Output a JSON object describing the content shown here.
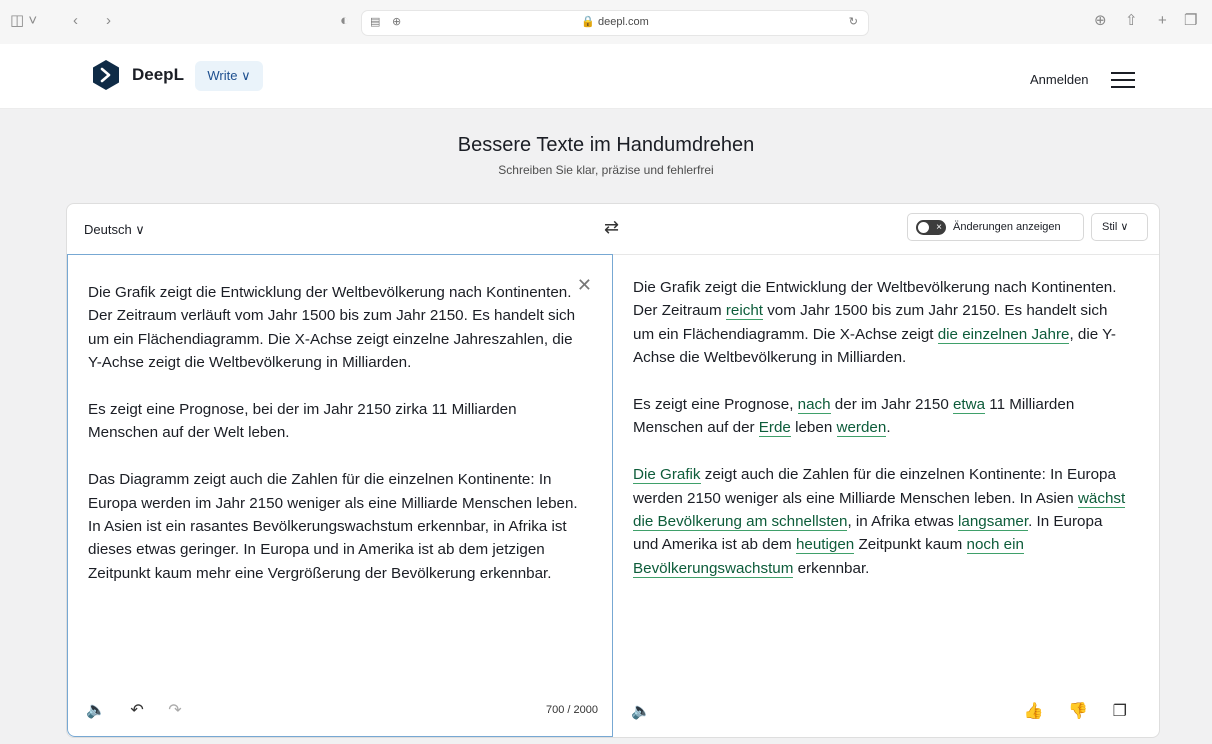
{
  "browser": {
    "url": "deepl.com"
  },
  "header": {
    "brand": "DeepL",
    "write_label": "Write ∨",
    "login": "Anmelden"
  },
  "hero": {
    "title": "Bessere Texte im Handumdrehen",
    "subtitle": "Schreiben Sie klar, präzise und fehlerfrei"
  },
  "editor": {
    "language": "Deutsch ∨",
    "changes_label": "Änderungen anzeigen",
    "style_label": "Stil ∨",
    "counter": "700 / 2000",
    "source_paragraphs": [
      "Die Grafik zeigt die Entwicklung der Weltbevölkerung nach Kontinenten. Der Zeitraum verläuft vom Jahr 1500 bis zum Jahr 2150. Es handelt sich um ein Flächendiagramm. Die X-Achse zeigt einzelne Jahreszahlen, die Y-Achse zeigt die Weltbevölkerung in Milliarden.",
      "Es zeigt eine Prognose, bei der im Jahr 2150 zirka 11 Milliarden Menschen auf der Welt leben.",
      "Das Diagramm zeigt auch die Zahlen für die einzelnen Kontinente: In Europa werden im Jahr 2150 weniger als eine Milliarde Menschen leben. In Asien ist ein rasantes Bevölkerungswachstum erkennbar, in Afrika ist dieses etwas geringer. In Europa und in Amerika ist ab dem jetzigen Zeitpunkt kaum mehr eine Vergrößerung der Bevölkerung erkennbar."
    ],
    "result": {
      "p1": {
        "a": "Die Grafik zeigt die Entwicklung der Weltbevölkerung nach Kontinenten. Der Zeitraum ",
        "h1": "reicht",
        "b": " vom Jahr 1500 bis zum Jahr 2150. Es handelt sich um ein Flächendiagramm. Die X-Achse zeigt ",
        "h2": "die einzelnen Jahre",
        "c": ", die Y-Achse die Weltbevölkerung in Milliarden."
      },
      "p2": {
        "a": "Es zeigt eine Prognose, ",
        "h1": "nach",
        "b": " der im Jahr 2150 ",
        "h2": "etwa",
        "c": " 11 Milliarden Menschen auf der ",
        "h3": "Erde",
        "d": " leben ",
        "h4": "werden",
        "e": "."
      },
      "p3": {
        "h1": "Die Grafik",
        "a": " zeigt auch die Zahlen für die einzelnen Kontinente: In Europa werden 2150 weniger als eine Milliarde Menschen leben. In Asien ",
        "h2": "wächst die Bevölkerung am schnellsten",
        "b": ", in Afrika etwas ",
        "h3": "langsamer",
        "c": ". In Europa und Amerika ist ab dem ",
        "h4": "heutigen",
        "d": " Zeitpunkt kaum ",
        "h5": "noch ein Bevölkerungswachstum",
        "e": " erkennbar."
      }
    }
  }
}
